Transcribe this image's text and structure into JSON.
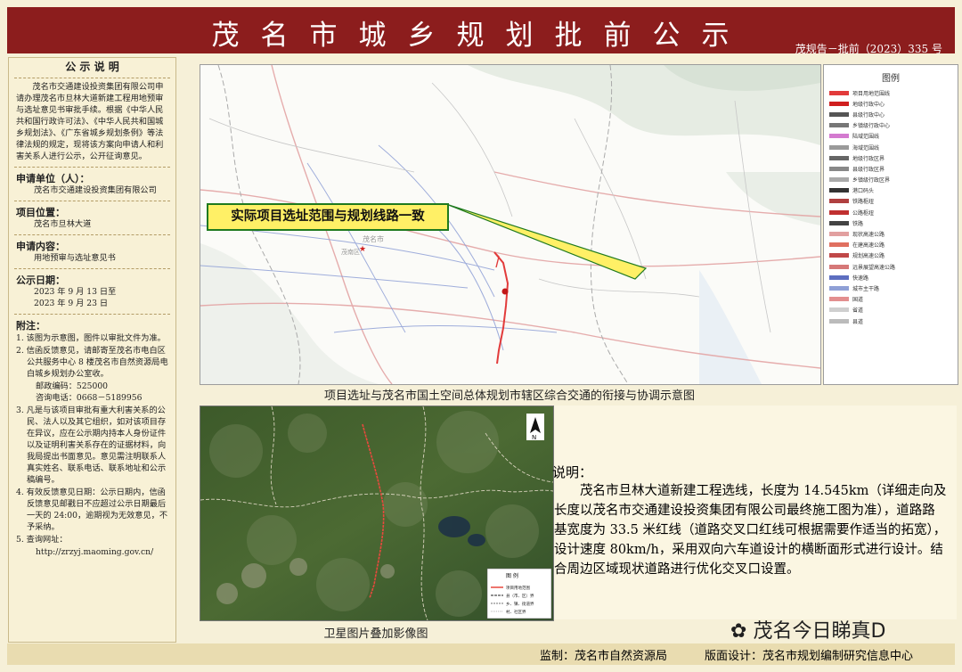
{
  "header": {
    "title": "茂名市城乡规划批前公示",
    "doc_number": "茂规告－批前（2023）335 号"
  },
  "notice": {
    "title": "公 示 说 明",
    "intro": "茂名市交通建设投资集团有限公司申请办理茂名市旦林大道新建工程用地预审与选址意见书审批手续。根据《中华人民共和国行政许可法》、《中华人民共和国城乡规划法》、《广东省城乡规划条例》等法律法规的规定，现将该方案向申请人和利害关系人进行公示，公开征询意见。",
    "applicant_label": "申请单位（人）：",
    "applicant": "茂名市交通建设投资集团有限公司",
    "location_label": "项目位置：",
    "location": "茂名市旦林大道",
    "content_label": "申请内容：",
    "content": "用地预审与选址意见书",
    "date_label": "公示日期：",
    "date_from": "2023 年 9 月 13 日至",
    "date_to": "2023 年 9 月 23 日"
  },
  "appendix": {
    "title": "附注：",
    "item1": "1. 该图为示意图，图件以审批文件为准。",
    "item2": "2. 信函反馈意见，请邮寄至茂名市电白区公共服务中心 8 楼茂名市自然资源局电白城乡规划办公室收。",
    "postcode": "邮政编码：525000",
    "phone": "咨询电话：0668－5189956",
    "item3": "3. 凡是与该项目审批有重大利害关系的公民、法人以及其它组织，如对该项目存在异议，应在公示期内持本人身份证件以及证明利害关系存在的证据材料，向我局提出书面意见。意见需注明联系人真实姓名、联系电话、联系地址和公示稿编号。",
    "item4": "4. 有效反馈意见日期：公示日期内，信函反馈意见邮戳日不应超过公示日期最后一天的 24:00，逾期视为无效意见，不予采纳。",
    "item5": "5. 查询网址：",
    "url": "http://zrzyj.maoming.gov.cn/"
  },
  "map1": {
    "callout": "实际项目选址范围与规划线路一致",
    "caption": "项目选址与茂名市国土空间总体规划市辖区综合交通的衔接与协调示意图",
    "place_maoming": "茂名市",
    "place_maonan": "茂南区"
  },
  "legend": {
    "title": "图例",
    "items": [
      {
        "label": "项目用地范围线",
        "color": "#e23b3b"
      },
      {
        "label": "地级行政中心",
        "color": "#d01f1f"
      },
      {
        "label": "县级行政中心",
        "color": "#555555"
      },
      {
        "label": "乡镇级行政中心",
        "color": "#777777"
      },
      {
        "label": "陆域范围线",
        "color": "#d47ad0"
      },
      {
        "label": "海域范围线",
        "color": "#9a9a9a"
      },
      {
        "label": "地级行政区界",
        "color": "#666666"
      },
      {
        "label": "县级行政区界",
        "color": "#888888"
      },
      {
        "label": "乡镇级行政区界",
        "color": "#aaaaaa"
      },
      {
        "label": "港口码头",
        "color": "#333333"
      },
      {
        "label": "铁路枢纽",
        "color": "#b04040"
      },
      {
        "label": "公路枢纽",
        "color": "#c03030"
      },
      {
        "label": "铁路",
        "color": "#444444"
      },
      {
        "label": "现状高速公路",
        "color": "#e2a0a0"
      },
      {
        "label": "在建高速公路",
        "color": "#e07060"
      },
      {
        "label": "规划高速公路",
        "color": "#c04848"
      },
      {
        "label": "远景展望高速公路",
        "color": "#d67878"
      },
      {
        "label": "快速路",
        "color": "#5d6ec0"
      },
      {
        "label": "城市主干路",
        "color": "#8fa0d6"
      },
      {
        "label": "国道",
        "color": "#e38f8f"
      },
      {
        "label": "省道",
        "color": "#cfcfcf"
      },
      {
        "label": "县道",
        "color": "#bbbbbb"
      }
    ]
  },
  "map2": {
    "caption": "卫星图片叠加影像图",
    "legend_title": "图 例",
    "legend_items": [
      "项目用地范围",
      "县（市、区）界",
      "乡、镇、街道界",
      "村、社区界"
    ],
    "north": "N"
  },
  "description": {
    "title": "说明：",
    "body": "茂名市旦林大道新建工程选线，长度为 14.545km（详细走向及长度以茂名市交通建设投资集团有限公司最终施工图为准），道路路基宽度为 33.5 米红线（道路交叉口红线可根据需要作适当的拓宽），设计速度 80km/h，采用双向六车道设计的横断面形式进行设计。结合周边区域现状道路进行优化交叉口设置。"
  },
  "footer": {
    "left": "监制：茂名市自然资源局",
    "right": "版面设计：茂名市规划编制研究信息中心"
  },
  "watermark": "茂名今日睇真D"
}
